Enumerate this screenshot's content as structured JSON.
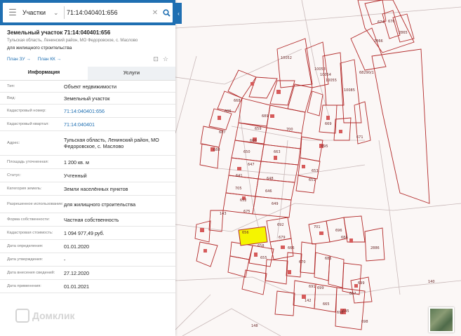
{
  "search": {
    "category": "Участки",
    "query": "71:14:040401:656"
  },
  "parcel": {
    "title": "Земельный участок 71:14:040401:656",
    "address": "Тульская область, Ленинский район, МО Федоровское, с. Маслово",
    "purpose": "для жилищного строительства",
    "links": [
      "План ЗУ →",
      "План КК →"
    ]
  },
  "tabs": [
    {
      "label": "Информация",
      "active": true
    },
    {
      "label": "Услуги",
      "active": false
    }
  ],
  "rows": [
    {
      "label": "Тип:",
      "value": "Объект недвижимости"
    },
    {
      "label": "Вид:",
      "value": "Земельный участок"
    },
    {
      "label": "Кадастровый номер:",
      "value": "71:14:040401:656",
      "link": true
    },
    {
      "label": "Кадастровый квартал:",
      "value": "71:14:040401",
      "link": true
    },
    {
      "label": "Адрес:",
      "value": "Тульская область, Ленинский район, МО Федоровское, с. Маслово"
    },
    {
      "label": "Площадь уточненная:",
      "value": "1 200 кв. м"
    },
    {
      "label": "Статус:",
      "value": "Учтенный"
    },
    {
      "label": "Категория земель:",
      "value": "Земли населённых пунктов"
    },
    {
      "label": "Разрешенное использование:",
      "value": "для жилищного строительства"
    },
    {
      "label": "Форма собственности:",
      "value": "Частная собственность"
    },
    {
      "label": "Кадастровая стоимость:",
      "value": "1 094 977,49 руб."
    },
    {
      "label": "Дата определения:",
      "value": "01.01.2020"
    },
    {
      "label": "Дата утверждения:",
      "value": "-"
    },
    {
      "label": "Дата внесения сведений:",
      "value": "27.12.2020"
    },
    {
      "label": "Дата применения:",
      "value": "01.01.2021"
    }
  ],
  "watermark": "Домклик",
  "map_labels": [
    "674",
    "676",
    "2865",
    "2866",
    "10052",
    "68290/1",
    "10053",
    "10054",
    "10055",
    "10085",
    "668",
    "686",
    "687",
    "688",
    "689",
    "656",
    "659",
    "700",
    "660",
    "650",
    "663",
    "647",
    "641",
    "648",
    "646",
    "705",
    "652",
    "675",
    "649",
    "143",
    "692",
    "679",
    "666",
    "670",
    "701",
    "695",
    "671",
    "653",
    "651",
    "669",
    "655",
    "658",
    "699",
    "140",
    "148",
    "696",
    "684",
    "685",
    "691",
    "699",
    "142",
    "665",
    "667",
    "645",
    "2886",
    "696",
    "698"
  ],
  "colors": {
    "brand": "#1f6fb2",
    "parcel_line": "#b22a2a",
    "selected_fill": "#f5f500"
  }
}
